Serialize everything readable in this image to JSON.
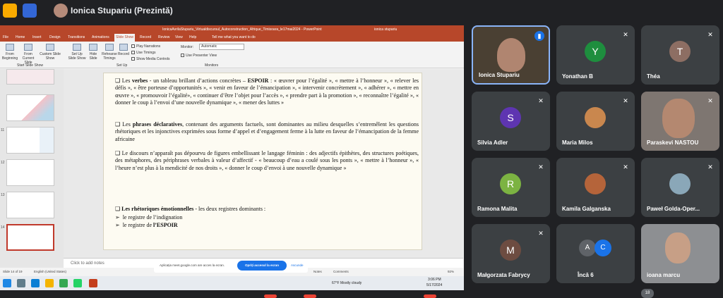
{
  "meet": {
    "presenter": "Ionica Stupariu (Prezintă)",
    "count": "18"
  },
  "ppt": {
    "title": "IonicaAvrilaStupariu_Virtualdiscursul_Autoconstruction_Afrique_Timisoara_le17mai2024 - PowerPoint",
    "user": "ionica stupariu",
    "menu": [
      "File",
      "Home",
      "Insert",
      "Design",
      "Transitions",
      "Animations",
      "Slide Show",
      "Record",
      "Review",
      "View",
      "Help",
      "Tell me what you want to do"
    ],
    "ribbon": {
      "buttons": [
        "From Beginning",
        "From Current Slide",
        "Custom Slide Show",
        "Set Up Slide Show",
        "Hide Slide",
        "Rehearse Timings",
        "Record"
      ],
      "checks": [
        "Play Narrations",
        "Use Timings",
        "Show Media Controls"
      ],
      "monitor_label": "Monitor:",
      "monitor_value": "Automatic",
      "presenter_view": "Use Presenter View",
      "groups": [
        "Start Slide Show",
        "Set Up",
        "Monitors"
      ]
    },
    "thumbs": [
      "9",
      "10",
      "11",
      "12",
      "13",
      "14"
    ],
    "slide": {
      "p1_a": "Les ",
      "p1_b": "verbes",
      "p1_c": "  - un tableau brillant d’actions concrètes – ",
      "p1_d": "ESPOIR",
      "p1_e": " :  « œuvrer pour l’égalité », « mettre à l’honneur »,  « relever les défis »,  « être porteuse d’opportunités »,  « venir en faveur de l’émancipation »,  « intervenir concrètement »,  « adhérer »,  « mettre en œuvre »,  « promouvoir l’égalité»,  « continuer d’être l’objet pour l’accès »,  « prendre part à la promotion »,  « reconnaître l’égalité »,  « donner le coup à l’envoi d’une nouvelle dynamique »,  « mener des luttes »",
      "p2_a": "Les ",
      "p2_b": "phrases déclaratives",
      "p2_c": ", contenant des arguments factuels, sont dominantes au milieu desquelles s’entremêlent les questions rhétoriques et les injonctives exprimées sous forme d’appel et d’engagement ferme à la lutte en faveur de l’émancipation de la femme africaine",
      "p3": "Le discours n’apparaît pas dépourvu de figures embellissant le langage féminin : des adjectifs épithètes, des structures poétiques, des métaphores, des périphrases verbales à valeur d’affectif  -  « beaucoup d’eau a coulé sous les ponts », « mettre à l’honneur », « l’heure n’est plus à la mendicité de nos droits », « donner le coup d’envoi à une nouvelle dynamique »",
      "p4_a": "Les rhétoriques émotionnelles",
      "p4_b": " - les deux registres dominants :",
      "p5": "le registre de l’indignation",
      "p6_a": "le registre de ",
      "p6_b": "l’ESPOIR"
    },
    "notes": "Click to add notes",
    "status": {
      "slide": "Slide 14 of 19",
      "lang": "English (United States)",
      "notes": "Notes",
      "comments": "Comments",
      "zoom": "92%"
    },
    "share": {
      "text": "Aplicația meet.google.com are acces la ecran.",
      "stop": "Opriți accesul la ecran",
      "hide": "Ascunde"
    },
    "taskbar": {
      "weather": "67°F  Mostly cloudy",
      "time": "3:06 PM",
      "date": "5/17/2024"
    }
  },
  "tiles": [
    {
      "name": "Ionica Stupariu"
    },
    {
      "name": "Yonathan B",
      "initial": "Y",
      "color": "#1e8e3e"
    },
    {
      "name": "Théa",
      "initial": "T",
      "color": "#8d6e63"
    },
    {
      "name": "Silvia Adler",
      "initial": "S",
      "color": "#5e35b1"
    },
    {
      "name": "Maria Milos"
    },
    {
      "name": "Paraskevi NASTOU"
    },
    {
      "name": "Ramona Malita",
      "initial": "R",
      "color": "#7cb342"
    },
    {
      "name": "Kamila Galganska"
    },
    {
      "name": "Paweł Golda-Oper..."
    },
    {
      "name": "Małgorzata Fabrycy",
      "initial": "M",
      "color": "#6d4c41"
    },
    {
      "name": "Încă 6",
      "a": "A",
      "c": "C"
    },
    {
      "name": "ioana marcu"
    }
  ]
}
